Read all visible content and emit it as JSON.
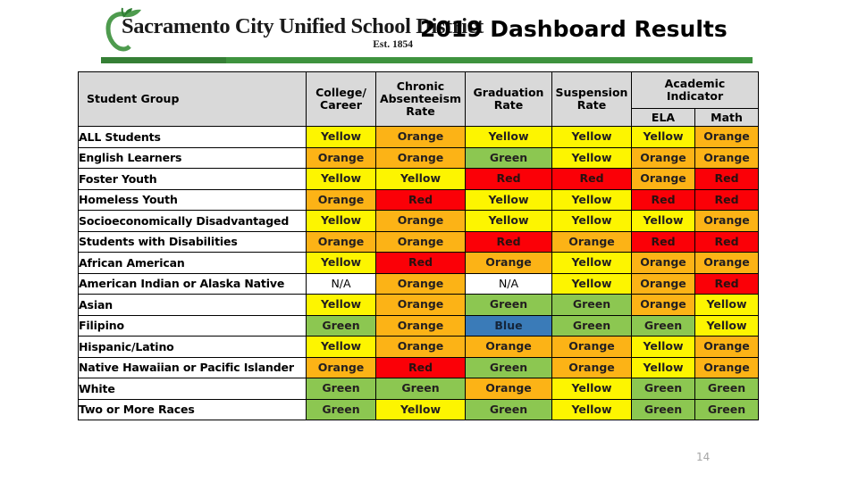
{
  "slide": {
    "title": "2019 Dashboard Results",
    "page_number": "14",
    "accent_green": "#3e933e"
  },
  "logo": {
    "name": "Sacramento City Unified School District",
    "established": "Est. 1854",
    "icon": "apple-icon"
  },
  "table": {
    "headers": {
      "student_group": "Student Group",
      "college_career": "College/\nCareer",
      "chronic_absenteeism": "Chronic\nAbsenteeism\nRate",
      "graduation_rate": "Graduation\nRate",
      "suspension_rate": "Suspension\nRate",
      "academic_indicator": "Academic\nIndicator",
      "ela": "ELA",
      "math": "Math"
    },
    "legend_colors": {
      "Red": "#fb0007",
      "Orange": "#fcb316",
      "Yellow": "#fdf500",
      "Green": "#8cc751",
      "Blue": "#3a7bb8",
      "N/A": "#ffffff"
    },
    "rows": [
      {
        "group": "ALL Students",
        "college_career": "Yellow",
        "chronic_absenteeism": "Orange",
        "graduation_rate": "Yellow",
        "suspension_rate": "Yellow",
        "ela": "Yellow",
        "math": "Orange"
      },
      {
        "group": "English Learners",
        "college_career": "Orange",
        "chronic_absenteeism": "Orange",
        "graduation_rate": "Green",
        "suspension_rate": "Yellow",
        "ela": "Orange",
        "math": "Orange"
      },
      {
        "group": "Foster Youth",
        "college_career": "Yellow",
        "chronic_absenteeism": "Yellow",
        "graduation_rate": "Red",
        "suspension_rate": "Red",
        "ela": "Orange",
        "math": "Red"
      },
      {
        "group": "Homeless Youth",
        "college_career": "Orange",
        "chronic_absenteeism": "Red",
        "graduation_rate": "Yellow",
        "suspension_rate": "Yellow",
        "ela": "Red",
        "math": "Red"
      },
      {
        "group": "Socioeconomically Disadvantaged",
        "college_career": "Yellow",
        "chronic_absenteeism": "Orange",
        "graduation_rate": "Yellow",
        "suspension_rate": "Yellow",
        "ela": "Yellow",
        "math": "Orange"
      },
      {
        "group": "Students with Disabilities",
        "college_career": "Orange",
        "chronic_absenteeism": "Orange",
        "graduation_rate": "Red",
        "suspension_rate": "Orange",
        "ela": "Red",
        "math": "Red"
      },
      {
        "group": "African American",
        "college_career": "Yellow",
        "chronic_absenteeism": "Red",
        "graduation_rate": "Orange",
        "suspension_rate": "Yellow",
        "ela": "Orange",
        "math": "Orange"
      },
      {
        "group": "American Indian or Alaska Native",
        "college_career": "N/A",
        "chronic_absenteeism": "Orange",
        "graduation_rate": "N/A",
        "suspension_rate": "Yellow",
        "ela": "Orange",
        "math": "Red"
      },
      {
        "group": "Asian",
        "college_career": "Yellow",
        "chronic_absenteeism": "Orange",
        "graduation_rate": "Green",
        "suspension_rate": "Green",
        "ela": "Orange",
        "math": "Yellow"
      },
      {
        "group": "Filipino",
        "college_career": "Green",
        "chronic_absenteeism": "Orange",
        "graduation_rate": "Blue",
        "suspension_rate": "Green",
        "ela": "Green",
        "math": "Yellow"
      },
      {
        "group": "Hispanic/Latino",
        "college_career": "Yellow",
        "chronic_absenteeism": "Orange",
        "graduation_rate": "Orange",
        "suspension_rate": "Orange",
        "ela": "Yellow",
        "math": "Orange"
      },
      {
        "group": "Native Hawaiian or Pacific Islander",
        "college_career": "Orange",
        "chronic_absenteeism": "Red",
        "graduation_rate": "Green",
        "suspension_rate": "Orange",
        "ela": "Yellow",
        "math": "Orange"
      },
      {
        "group": "White",
        "college_career": "Green",
        "chronic_absenteeism": "Green",
        "graduation_rate": "Orange",
        "suspension_rate": "Yellow",
        "ela": "Green",
        "math": "Green"
      },
      {
        "group": "Two or More Races",
        "college_career": "Green",
        "chronic_absenteeism": "Yellow",
        "graduation_rate": "Green",
        "suspension_rate": "Yellow",
        "ela": "Green",
        "math": "Green"
      }
    ]
  }
}
